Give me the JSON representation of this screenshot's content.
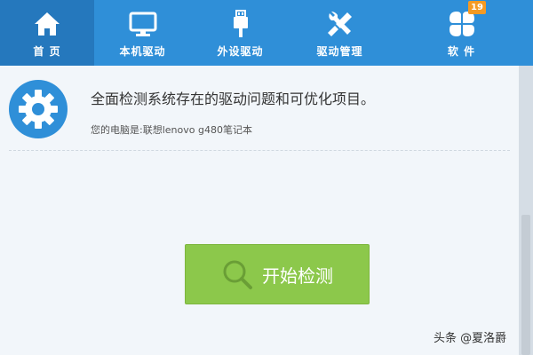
{
  "nav": {
    "items": [
      {
        "label": "首 页",
        "icon": "home-icon",
        "active": true
      },
      {
        "label": "本机驱动",
        "icon": "monitor-icon",
        "active": false
      },
      {
        "label": "外设驱动",
        "icon": "usb-plug-icon",
        "active": false
      },
      {
        "label": "驱动管理",
        "icon": "tools-icon",
        "active": false
      },
      {
        "label": "软 件",
        "icon": "software-grid-icon",
        "active": false,
        "badge": "19"
      }
    ]
  },
  "info": {
    "icon": "gear-icon",
    "title": "全面检测系统存在的驱动问题和可优化项目。",
    "subtitle": "您的电脑是:联想lenovo g480笔记本"
  },
  "actions": {
    "start_label": "开始检测"
  },
  "watermark": {
    "text": "头条 @夏洛爵"
  },
  "colors": {
    "nav_bg": "#2f8fd8",
    "nav_active_bg": "#2578bd",
    "button_green": "#8cc84b",
    "badge_orange": "#f59a23"
  }
}
